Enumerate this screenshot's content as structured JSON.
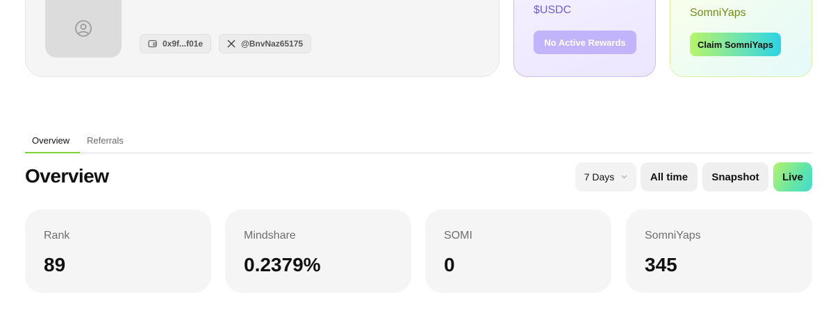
{
  "profile": {
    "wallet_chip": "0x9f...f01e",
    "x_handle_chip": "@BnvNaz65175"
  },
  "rewards": {
    "usdc": {
      "title": "$USDC",
      "button_label": "No Active Rewards"
    },
    "somniyaps": {
      "title": "SomniYaps",
      "button_label": "Claim SomniYaps"
    }
  },
  "tabs": [
    {
      "label": "Overview",
      "active": true
    },
    {
      "label": "Referrals",
      "active": false
    }
  ],
  "overview": {
    "title": "Overview",
    "filters": {
      "days_select": "7 Days",
      "all_time": "All time",
      "snapshot": "Snapshot",
      "live": "Live"
    },
    "stats": [
      {
        "label": "Rank",
        "value": "89"
      },
      {
        "label": "Mindshare",
        "value": "0.2379%"
      },
      {
        "label": "SOMI",
        "value": "0"
      },
      {
        "label": "SomniYaps",
        "value": "345"
      }
    ]
  },
  "colors": {
    "tab_underline": "#7fd13b",
    "usdc_accent": "#6e5fd6",
    "somni_accent": "#6f8d18"
  },
  "icons": [
    "user-circle-icon",
    "wallet-icon",
    "x-logo-icon",
    "chevron-down-icon"
  ]
}
